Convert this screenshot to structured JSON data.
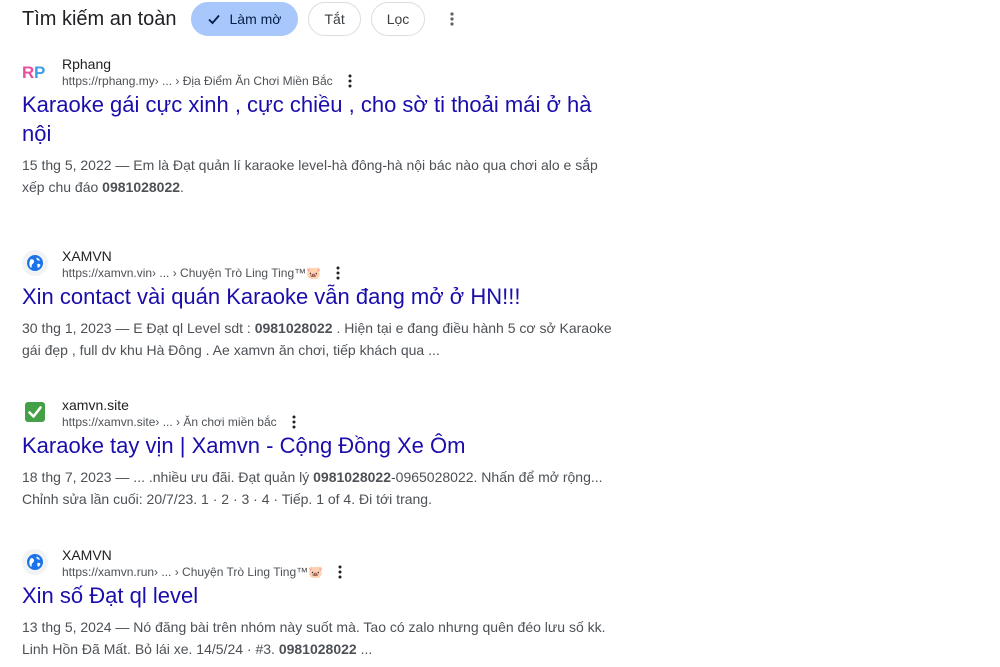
{
  "toolbar": {
    "safe_search_label": "Tìm kiếm an toàn",
    "chips": [
      {
        "label": "Làm mờ",
        "active": true
      },
      {
        "label": "Tắt",
        "active": false
      },
      {
        "label": "Lọc",
        "active": false
      }
    ],
    "more_icon": "vertical-dots-icon"
  },
  "results": [
    {
      "site_name": "Rphang",
      "favicon": {
        "type": "rp-logo",
        "text_r": "R",
        "text_p": "P"
      },
      "url": "https://rphang.my",
      "breadcrumb": " › ... › Địa Điểm Ăn Chơi Miền Bắc",
      "title": "Karaoke gái cực xinh , cực chiều , cho sờ ti thoải mái ở hà nội",
      "snippet_pre": "15 thg 5, 2022 — Em là Đạt quản lí karaoke level-hà đông-hà nội bác nào qua chơi alo e sắp xếp chu đáo ",
      "snippet_bold": "0981028022",
      "snippet_post": "."
    },
    {
      "site_name": "XAMVN",
      "favicon": {
        "type": "globe-icon"
      },
      "url": "https://xamvn.vin",
      "breadcrumb": " › ... › Chuyện Trò Ling Ting™🐷",
      "title": "Xin contact vài quán Karaoke vẫn đang mở ở HN!!!",
      "snippet_pre": "30 thg 1, 2023 — E Đạt ql Level sdt : ",
      "snippet_bold": "0981028022",
      "snippet_post": " . Hiện tại e đang điều hành 5 cơ sở Karaoke gái đẹp , full dv khu Hà Đông . Ae xamvn ăn chơi, tiếp khách qua ..."
    },
    {
      "site_name": "xamvn.site",
      "favicon": {
        "type": "green-check-icon"
      },
      "url": "https://xamvn.site",
      "breadcrumb": " › ... › Ăn chơi miền bắc",
      "title": "Karaoke tay vịn | Xamvn - Cộng Đồng Xe Ôm",
      "snippet_pre": "18 thg 7, 2023 — ... .nhiều ưu đãi. Đạt quản lý ",
      "snippet_bold": "0981028022",
      "snippet_post": "-0965028022. Nhấn để mở rộng... Chỉnh sửa lần cuối: 20/7/23. 1 · 2 · 3 · 4 · Tiếp. 1 of 4. Đi tới trang."
    },
    {
      "site_name": "XAMVN",
      "favicon": {
        "type": "globe-icon"
      },
      "url": "https://xamvn.run",
      "breadcrumb": " › ... › Chuyện Trò Ling Ting™🐷",
      "title": "Xin số Đạt ql level",
      "snippet_pre": "13 thg 5, 2024 — Nó đăng bài trên nhóm này suốt mà. Tao có zalo nhưng quên đéo lưu số kk. Linh Hồn Đã Mất. Bỏ lái xe. 14/5/24 · #3. ",
      "snippet_bold": "0981028022",
      "snippet_post": " ..."
    }
  ],
  "colors": {
    "link": "#1a0dab",
    "chip_active_bg": "#a8c7fa",
    "snippet": "#4d5156",
    "globe": "#1a73e8",
    "check_green": "#43a047"
  }
}
